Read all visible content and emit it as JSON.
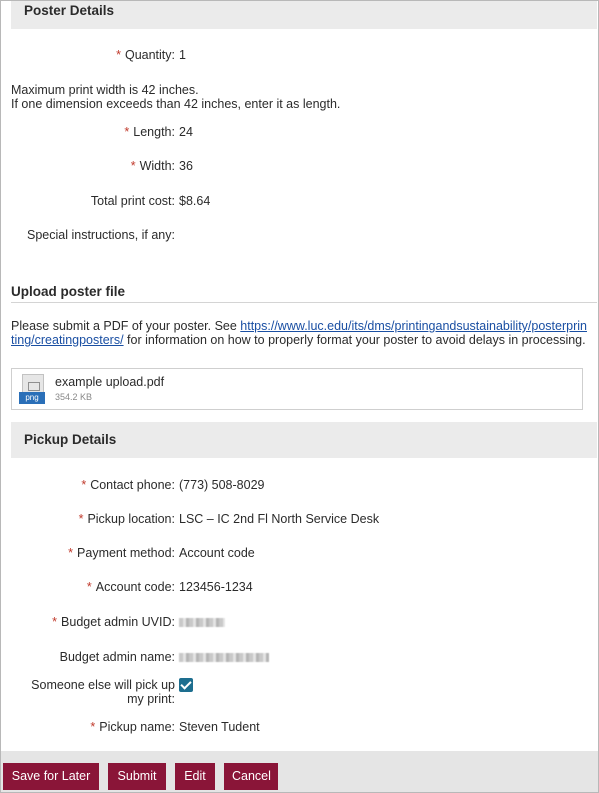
{
  "poster_details": {
    "heading": "Poster Details",
    "quantity": {
      "label": "Quantity:",
      "value": "1"
    },
    "note_line1": "Maximum print width is 42 inches.",
    "note_line2": "If one dimension exceeds than 42 inches, enter it as length.",
    "length": {
      "label": "Length:",
      "value": "24"
    },
    "width": {
      "label": "Width:",
      "value": "36"
    },
    "total_cost": {
      "label": "Total print cost:",
      "value": "$8.64"
    },
    "special_instructions": {
      "label": "Special instructions, if any:",
      "value": ""
    }
  },
  "upload": {
    "heading": "Upload poster file",
    "text_before": "Please submit a PDF of your poster. See ",
    "link": "https://www.luc.edu/its/dms/printingandsustainability/posterprinting/creatingposters/",
    "text_after": " for information on how to properly format your poster to avoid delays in processing.",
    "file": {
      "name": "example upload.pdf",
      "size": "354.2 KB",
      "type_tag": "png",
      "icon": "image-file-icon"
    }
  },
  "pickup_details": {
    "heading": "Pickup Details",
    "contact_phone": {
      "label": "Contact phone:",
      "value": "(773) 508-8029"
    },
    "pickup_location": {
      "label": "Pickup location:",
      "value": "LSC – IC 2nd Fl North Service Desk"
    },
    "payment_method": {
      "label": "Payment method:",
      "value": "Account code"
    },
    "account_code": {
      "label": "Account code:",
      "value": "123456-1234"
    },
    "budget_admin_uvid": {
      "label": "Budget admin UVID:"
    },
    "budget_admin_name": {
      "label": "Budget admin name:"
    },
    "someone_else": {
      "label_line1": "Someone else will pick up",
      "label_line2": "my print:",
      "checked": true
    },
    "pickup_name": {
      "label": "Pickup name:",
      "value": "Steven Tudent"
    }
  },
  "actions": {
    "save_later": "Save for Later",
    "submit": "Submit",
    "edit": "Edit",
    "cancel": "Cancel"
  },
  "colors": {
    "button_bg": "#8a1538",
    "required_star": "#c0392b",
    "link": "#1a4fa3",
    "checkbox": "#1d6e8f",
    "section_bg": "#ebebeb"
  },
  "required_marker": "*"
}
